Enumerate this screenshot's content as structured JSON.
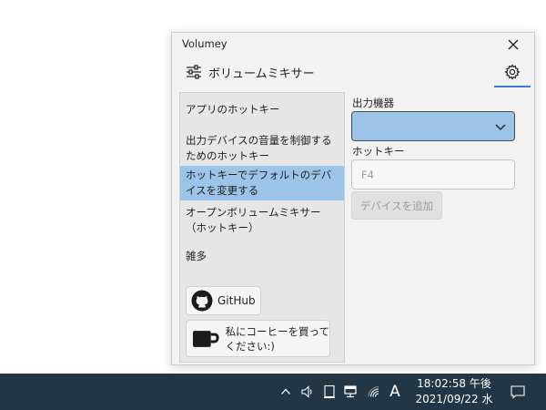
{
  "window": {
    "title": "Volumey",
    "heading": "ボリュームミキサー",
    "close_icon": "close-icon",
    "settings_icon": "gear-icon"
  },
  "sidebar": {
    "items": [
      {
        "label": "アプリのホットキー"
      },
      {
        "label": "出力デバイスの音量を制御するためのホットキー"
      },
      {
        "label": "ホットキーでデフォルトのデバイスを変更する",
        "selected": true
      },
      {
        "label": "オープンボリュームミキサー（ホットキー）"
      },
      {
        "label": "雑多"
      }
    ],
    "github_label": "GitHub",
    "coffee_label": "私にコーヒーを買ってください:)"
  },
  "panel": {
    "output_device_label": "出力機器",
    "output_device_value": "",
    "hotkey_label": "ホットキー",
    "hotkey_placeholder": "F4",
    "add_device_label": "デバイスを追加"
  },
  "taskbar": {
    "ime_label": "A",
    "time": "18:02:58 午後",
    "date": "2021/09/22 水"
  },
  "colors": {
    "selection": "#9bc4e8",
    "accent": "#3a7bd5",
    "taskbar": "#233645"
  }
}
